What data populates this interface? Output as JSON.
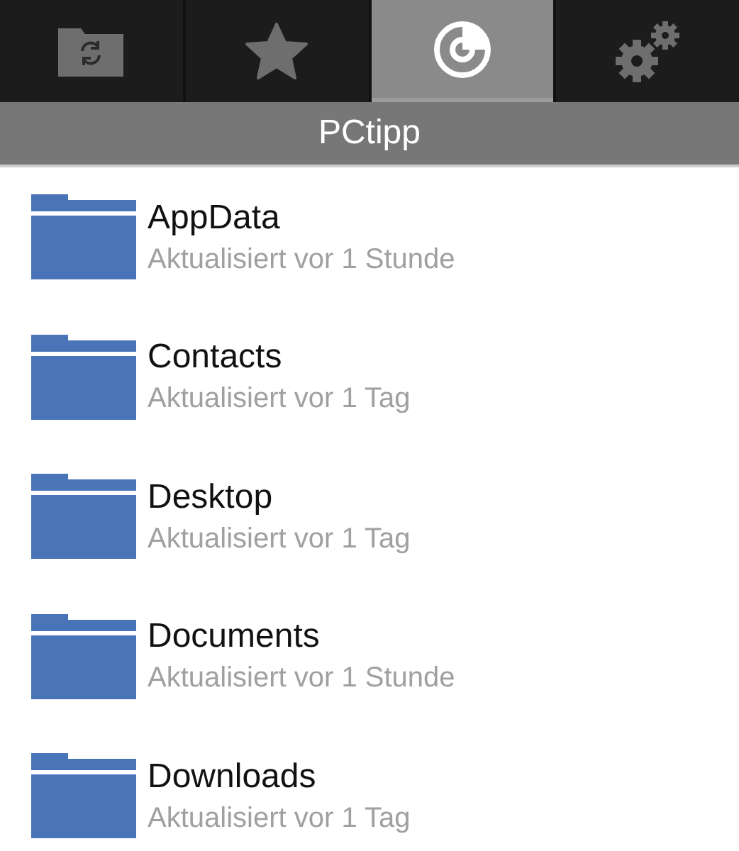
{
  "tabs": [
    {
      "kind": "sync-folder",
      "selected": false
    },
    {
      "kind": "star",
      "selected": false
    },
    {
      "kind": "disk",
      "selected": true
    },
    {
      "kind": "gears",
      "selected": false
    }
  ],
  "title": "PCtipp",
  "folders": [
    {
      "name": "AppData",
      "updated": "Aktualisiert vor 1 Stunde"
    },
    {
      "name": "Contacts",
      "updated": "Aktualisiert vor 1 Tag"
    },
    {
      "name": "Desktop",
      "updated": "Aktualisiert vor 1 Tag"
    },
    {
      "name": "Documents",
      "updated": "Aktualisiert vor 1 Stunde"
    },
    {
      "name": "Downloads",
      "updated": "Aktualisiert vor 1 Tag"
    }
  ]
}
